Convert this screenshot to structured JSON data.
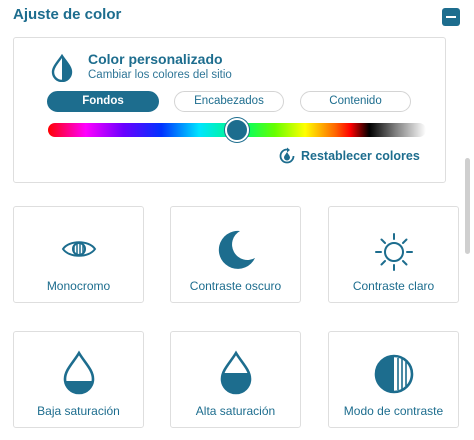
{
  "panel": {
    "title": "Ajuste de color",
    "collapse_icon": "minus-icon"
  },
  "color_card": {
    "title": "Color personalizado",
    "subtitle": "Cambiar los colores del sitio",
    "icon": "drop-half-icon",
    "tabs": [
      {
        "label": "Fondos",
        "active": true
      },
      {
        "label": "Encabezados",
        "active": false
      },
      {
        "label": "Contenido",
        "active": false
      }
    ],
    "slider_value_fraction": 0.5,
    "reset_label": "Restablecer colores",
    "reset_icon": "reset-icon"
  },
  "tiles": [
    {
      "label": "Monocromo",
      "icon": "eye-icon"
    },
    {
      "label": "Contraste oscuro",
      "icon": "moon-icon"
    },
    {
      "label": "Contraste claro",
      "icon": "sun-icon"
    },
    {
      "label": "Baja saturación",
      "icon": "drop-low-icon"
    },
    {
      "label": "Alta saturación",
      "icon": "drop-high-icon"
    },
    {
      "label": "Modo de contraste",
      "icon": "contrast-icon"
    }
  ],
  "colors": {
    "accent": "#1d6d8e",
    "border": "#dedede"
  }
}
